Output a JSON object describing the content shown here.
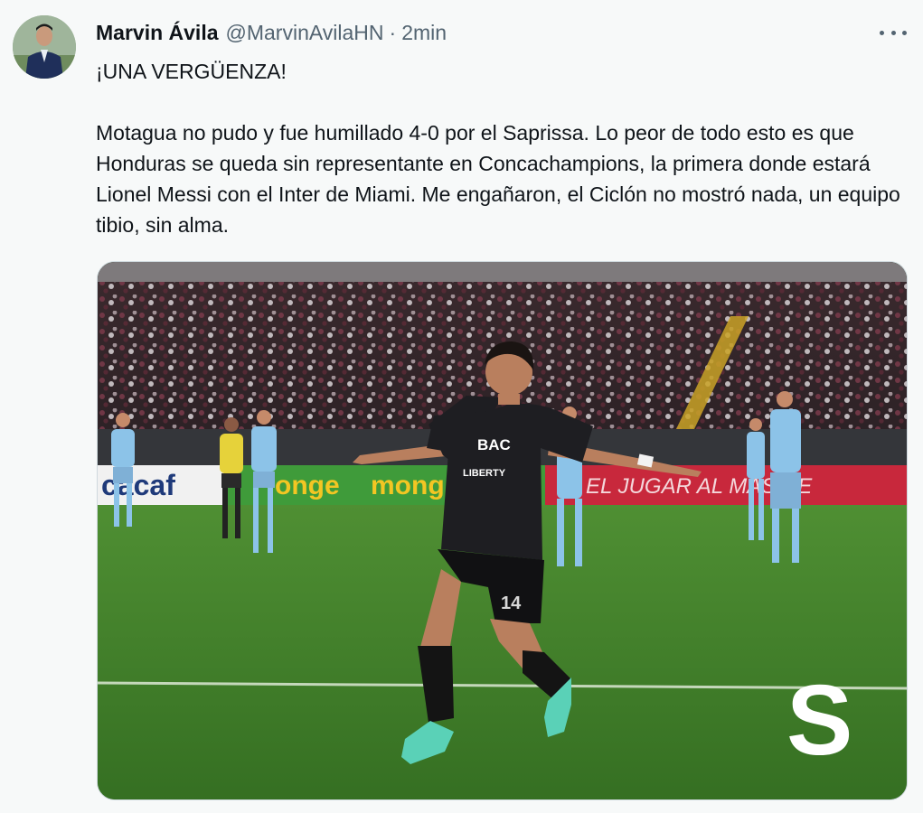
{
  "author": {
    "name": "Marvin Ávila",
    "handle": "@MarvinAvilaHN",
    "separator": "·",
    "time": "2min"
  },
  "tweet": {
    "headline": "¡UNA VERGÜENZA!",
    "body": "Motagua no pudo y fue humillado 4-0 por el Saprissa. Lo peor de todo esto es que Honduras se queda sin representante en Concachampions, la primera donde estará Lionel Messi con el Inter de Miami. Me engañaron, el Ciclón no mostró nada, un equipo tibio, sin alma."
  },
  "media": {
    "sponsor_text": "BAC",
    "jersey_sponsor": "LIBERTY",
    "jersey_number": "14",
    "ad_board_left": "cacaf",
    "ad_board_mid_1": "onge",
    "ad_board_mid_2": "mong",
    "ad_board_right": "EL JUGAR  AL  MAS DE",
    "club_mark": "S"
  },
  "colors": {
    "background": "#f7f9f9",
    "secondary_text": "#536471",
    "pitch": "#3f7a2a",
    "away_kit": "#8cc3e8",
    "home_kit": "#1e1e22"
  }
}
